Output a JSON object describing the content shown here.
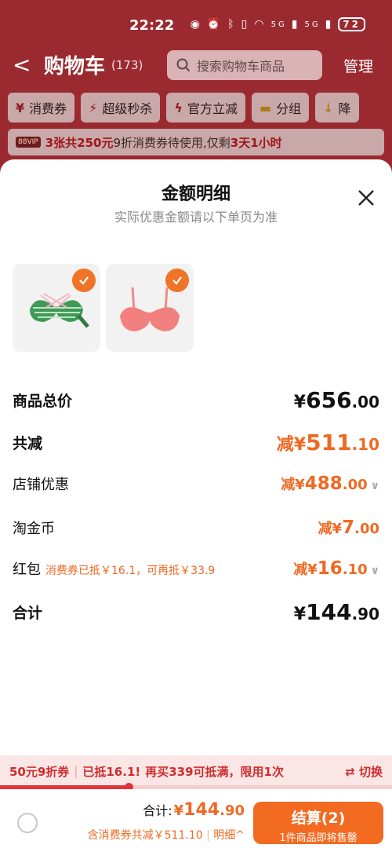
{
  "status_bar": {
    "time": "22:22",
    "battery": "72",
    "network_1": "5G",
    "network_2": "5G"
  },
  "nav": {
    "back": "<",
    "title": "购物车",
    "count": "(173)",
    "search_placeholder": "搜索购物车商品",
    "manage": "管理"
  },
  "chips": [
    {
      "icon": "coupon-icon",
      "label": "消费券"
    },
    {
      "icon": "flash-sale-icon",
      "label": "超级秒杀"
    },
    {
      "icon": "lightning-icon",
      "label": "官方立减"
    },
    {
      "icon": "folder-icon",
      "label": "分组"
    },
    {
      "icon": "price-down-icon",
      "label": "降"
    }
  ],
  "banner": {
    "vip": "88VIP",
    "highlight1": "3张共250元",
    "text1": "9折消费券待使用,仅剩",
    "highlight2": "3天1小时"
  },
  "sheet": {
    "title": "金额明细",
    "subtitle": "实际优惠金额请以下单页为准",
    "rows": {
      "subtotal": {
        "label": "商品总价",
        "prefix": "¥",
        "int": "656",
        "dec": ".00"
      },
      "total_reduced": {
        "label": "共减",
        "prefix": "减¥",
        "int": "511",
        "dec": ".10"
      },
      "shop_discount": {
        "label": "店铺优惠",
        "prefix": "减¥",
        "int": "488",
        "dec": ".00"
      },
      "taojinbi": {
        "label": "淘金币",
        "prefix": "减¥",
        "int": "7",
        "dec": ".00"
      },
      "red_packet": {
        "label": "红包",
        "note": "消费券已抵￥16.1，可再抵￥33.9",
        "prefix": "减¥",
        "int": "16",
        "dec": ".10"
      },
      "grand_total": {
        "label": "合计",
        "prefix": "¥",
        "int": "144",
        "dec": ".90"
      }
    }
  },
  "promo": {
    "coupon": "50元9折券",
    "applied": "已抵16.1!",
    "hint": "再买339可抵满，限用1次",
    "switch": "⇄ 切换",
    "progress": 0.33
  },
  "footer": {
    "total_label": "合计:",
    "total_prefix": "¥",
    "total_int": "144",
    "total_dec": ".90",
    "discount_text": "含消费券共减￥511.10",
    "detail": "明细^",
    "checkout_label": "结算(2)",
    "checkout_sub": "1件商品即将售罄"
  },
  "colors": {
    "accent": "#f26b21",
    "price_orange": "#ee6a24",
    "header_red": "#9b2a30"
  }
}
